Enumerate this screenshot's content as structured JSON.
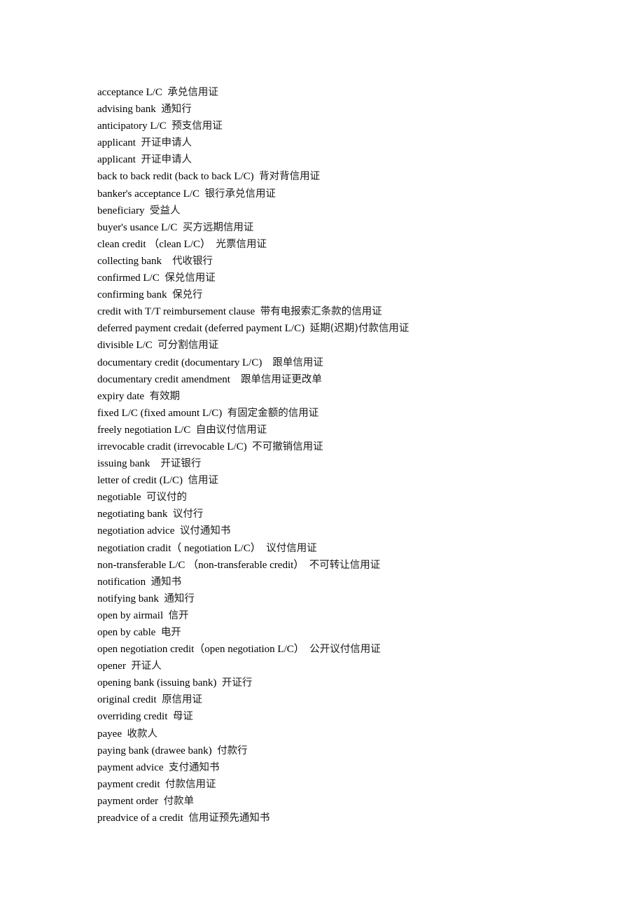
{
  "document": {
    "entries": [
      {
        "term": "acceptance L/C",
        "sep": "  ",
        "translation": "承兑信用证"
      },
      {
        "term": "advising bank",
        "sep": "  ",
        "translation": "通知行"
      },
      {
        "term": "anticipatory L/C",
        "sep": "  ",
        "translation": "预支信用证"
      },
      {
        "term": "applicant",
        "sep": "  ",
        "translation": "开证申请人"
      },
      {
        "term": "applicant",
        "sep": "  ",
        "translation": "开证申请人"
      },
      {
        "term": "back to back redit (back to back L/C)",
        "sep": "  ",
        "translation": "背对背信用证"
      },
      {
        "term": "banker's acceptance L/C",
        "sep": "  ",
        "translation": "银行承兑信用证"
      },
      {
        "term": "beneficiary",
        "sep": "  ",
        "translation": "受益人"
      },
      {
        "term": "buyer's usance L/C",
        "sep": "  ",
        "translation": "买方远期信用证"
      },
      {
        "term": "clean credit （clean L/C）",
        "sep": "  ",
        "translation": "光票信用证"
      },
      {
        "term": "collecting bank",
        "sep": "    ",
        "translation": "代收银行"
      },
      {
        "term": "confirmed L/C",
        "sep": "  ",
        "translation": "保兑信用证"
      },
      {
        "term": "confirming bank",
        "sep": "  ",
        "translation": "保兑行"
      },
      {
        "term": "credit with T/T reimbursement clause",
        "sep": "  ",
        "translation": "带有电报索汇条款的信用证"
      },
      {
        "term": "deferred payment credait (deferred payment L/C)",
        "sep": "  ",
        "translation": "延期(迟期)付款信用证"
      },
      {
        "term": "divisible L/C",
        "sep": "  ",
        "translation": "可分割信用证"
      },
      {
        "term": "documentary credit (documentary L/C)",
        "sep": "    ",
        "translation": "跟单信用证"
      },
      {
        "term": "documentary credit amendment",
        "sep": "    ",
        "translation": "跟单信用证更改单"
      },
      {
        "term": "expiry date",
        "sep": "  ",
        "translation": "有效期"
      },
      {
        "term": "fixed L/C (fixed amount L/C)",
        "sep": "  ",
        "translation": "有固定金额的信用证"
      },
      {
        "term": "freely negotiation L/C",
        "sep": "  ",
        "translation": "自由议付信用证"
      },
      {
        "term": "irrevocable cradit (irrevocable L/C)",
        "sep": "  ",
        "translation": "不可撤销信用证"
      },
      {
        "term": "issuing bank",
        "sep": "    ",
        "translation": "开证银行"
      },
      {
        "term": "letter of credit (L/C)",
        "sep": "  ",
        "translation": "信用证"
      },
      {
        "term": "negotiable",
        "sep": "  ",
        "translation": "可议付的"
      },
      {
        "term": "negotiating bank",
        "sep": "  ",
        "translation": "议付行"
      },
      {
        "term": "negotiation advice",
        "sep": "  ",
        "translation": "议付通知书"
      },
      {
        "term": "negotiation cradit（ negotiation L/C）",
        "sep": "  ",
        "translation": "议付信用证"
      },
      {
        "term": "non-transferable L/C （non-transferable credit）",
        "sep": "  ",
        "translation": "不可转让信用证"
      },
      {
        "term": "notification",
        "sep": "  ",
        "translation": "通知书"
      },
      {
        "term": "notifying bank",
        "sep": "  ",
        "translation": "通知行"
      },
      {
        "term": "open by airmail",
        "sep": "  ",
        "translation": "信开"
      },
      {
        "term": "open by cable",
        "sep": "  ",
        "translation": "电开"
      },
      {
        "term": "open negotiation credit（open negotiation L/C）",
        "sep": "  ",
        "translation": "公开议付信用证"
      },
      {
        "term": "opener",
        "sep": "  ",
        "translation": "开证人"
      },
      {
        "term": "opening bank (issuing bank)",
        "sep": "  ",
        "translation": "开证行"
      },
      {
        "term": "original credit",
        "sep": "  ",
        "translation": "原信用证"
      },
      {
        "term": "overriding credit",
        "sep": "  ",
        "translation": "母证"
      },
      {
        "term": "payee",
        "sep": "  ",
        "translation": "收款人"
      },
      {
        "term": "paying bank (drawee bank)",
        "sep": "  ",
        "translation": "付款行"
      },
      {
        "term": "payment advice",
        "sep": "  ",
        "translation": "支付通知书"
      },
      {
        "term": "payment credit",
        "sep": "  ",
        "translation": "付款信用证"
      },
      {
        "term": "payment order",
        "sep": "  ",
        "translation": "付款单"
      },
      {
        "term": "preadvice of a credit",
        "sep": "  ",
        "translation": "信用证预先通知书"
      }
    ]
  }
}
